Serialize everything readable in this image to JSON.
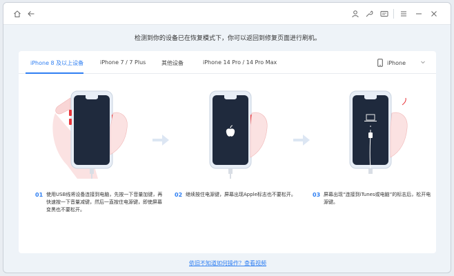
{
  "titlebar": {
    "icons": [
      "home-icon",
      "back-icon",
      "user-icon",
      "wrench-icon",
      "message-icon",
      "menu-icon",
      "minimize-icon",
      "close-icon"
    ]
  },
  "instruction": "检测到你的设备已在恢复模式下，你可以返回到修复页面进行刷机。",
  "tabs": [
    {
      "label": "iPhone 8 及以上设备",
      "active": true
    },
    {
      "label": "iPhone 7 / 7 Plus",
      "active": false
    },
    {
      "label": "其他设备",
      "active": false
    },
    {
      "label": "iPhone 14 Pro / 14 Pro Max",
      "active": false
    }
  ],
  "device_select": {
    "value": "iPhone"
  },
  "steps": [
    {
      "num": "01",
      "text": "使用USB线将设备连接到电脑，先按一下音量加键，再快速按一下音量减键，然后一直按住电源键，即使屏幕变黑也不要松开。"
    },
    {
      "num": "02",
      "text": "继续按住电源键，屏幕出现Apple标志也不要松开。"
    },
    {
      "num": "03",
      "text": "屏幕出现“连接到iTunes或电脑”的标志后，松开电源键。"
    }
  ],
  "help_link": "依旧不知道如何操作？查看视频",
  "colors": {
    "accent": "#2f7ff2",
    "phone_screen": "#1f2a3d",
    "hand": "#f7d7d7"
  }
}
